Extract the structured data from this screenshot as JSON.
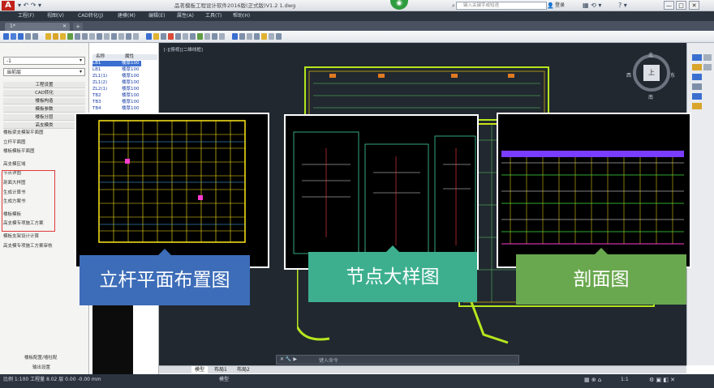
{
  "titlebar": {
    "logo": "A",
    "title": "品茗模板工程设计软件2016版(正式版)V1.2    1.dwg",
    "search_placeholder": "键入关键字或短语",
    "user": "登录",
    "min": "—",
    "max": "□",
    "close": "✕"
  },
  "menubar": {
    "items": [
      "工程(F)",
      "视图(V)",
      "CAD转化(J)",
      "建模(M)",
      "编辑(E)",
      "属性(A)",
      "工具(T)",
      "帮助(H)"
    ]
  },
  "tabs": {
    "doc_tab": "1*",
    "new_tab": "+"
  },
  "leftpanel": {
    "select1": "-1",
    "select2": "当前层",
    "buttons": [
      "工程设置",
      "CAD转化",
      "楼板构造",
      "模板参数",
      "楼板分层",
      "高支模类"
    ],
    "items": [
      "楼板梁支模架平面图",
      "立杆平面图",
      "楼板模板平面图",
      "",
      "高支模区域",
      "节点详图",
      "剖面大样图",
      "生成计算书",
      "生成方案书",
      "",
      "楼板模板",
      "高支模专项施工方案",
      "",
      "模板支架设计计算",
      "高支模专项施工方案审核"
    ],
    "bottom1": "楼板配置/墙柱配",
    "bottom2": "输出设置"
  },
  "tablepanel": {
    "headers": [
      "名称",
      "属性"
    ],
    "rows": [
      [
        "LB1",
        "楼厚100"
      ],
      [
        "LB1",
        "楼厚100"
      ],
      [
        "ZL1(1)",
        "楼厚100"
      ],
      [
        "ZL1(2)",
        "楼厚100"
      ],
      [
        "ZL2(1)",
        "楼厚100"
      ],
      [
        "TB2",
        "楼厚100"
      ],
      [
        "TB3",
        "楼厚100"
      ],
      [
        "TB4",
        "楼厚100"
      ]
    ]
  },
  "canvas": {
    "label": "[-][俯视][二维线框]",
    "compass": {
      "north": "北",
      "south": "南",
      "east": "东",
      "west": "西",
      "center": "上"
    },
    "command_placeholder": "键入命令"
  },
  "layout_tabs": [
    "模型",
    "布局1",
    "布局2"
  ],
  "statusbar": {
    "coords": "比例 1:100  工程量 8.02  层 0.00  -0.00 mm",
    "model": "模型",
    "scale": "1:1"
  },
  "overlays": [
    {
      "label": "立杆平面布置图",
      "color": "#3d6db8"
    },
    {
      "label": "节点大样图",
      "color": "#3daf8f"
    },
    {
      "label": "剖面图",
      "color": "#6aa84f"
    }
  ]
}
